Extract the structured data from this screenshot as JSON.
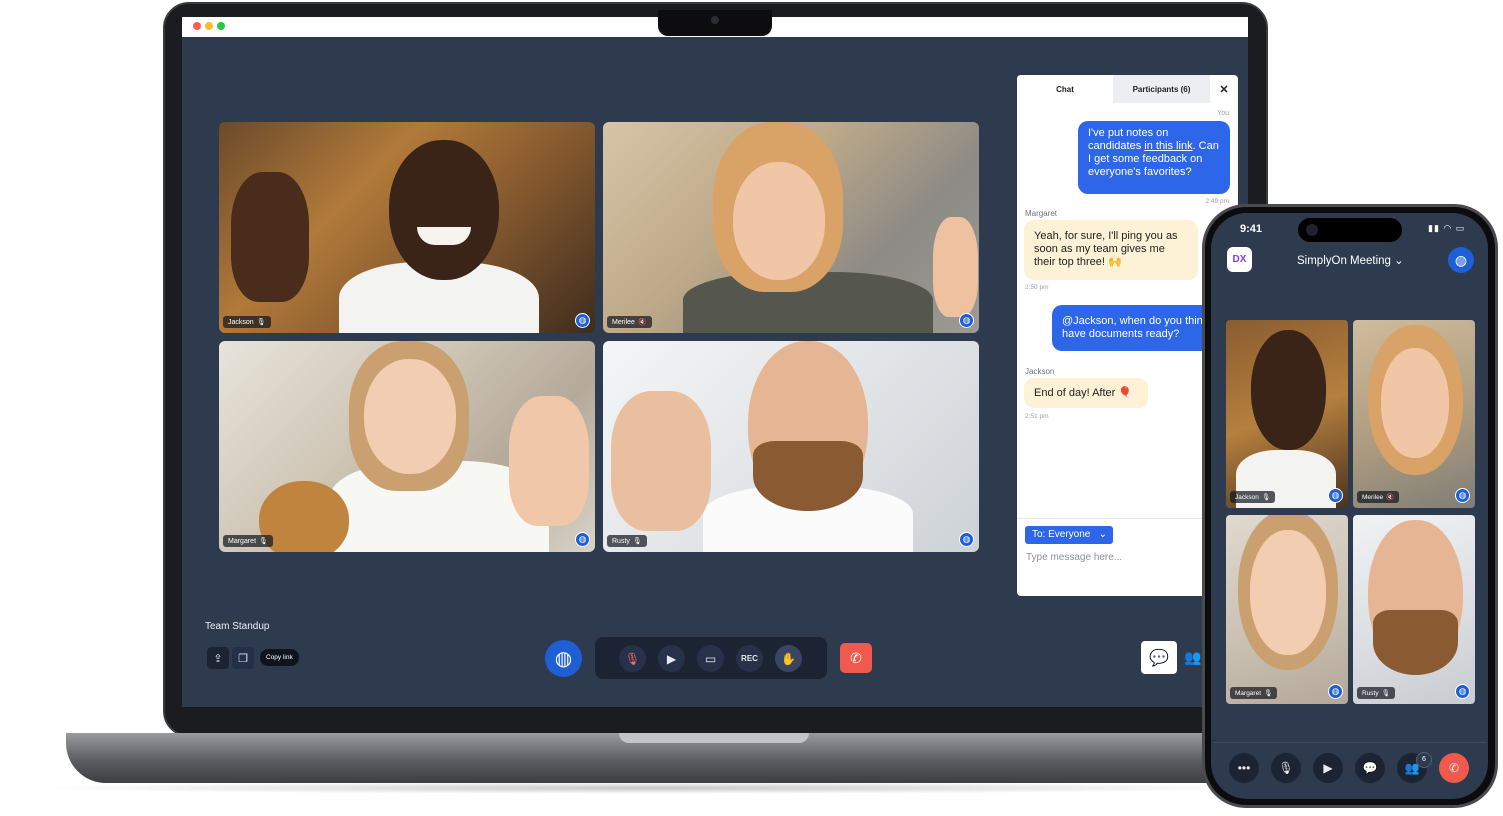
{
  "laptop": {
    "meeting_title": "Team Standup",
    "copy_link_label": "Copy link",
    "rec_label": "REC"
  },
  "participants": [
    {
      "name": "Jackson",
      "mic": "mic-on"
    },
    {
      "name": "Merilee",
      "mic": "mic-off"
    },
    {
      "name": "Margaret",
      "mic": "mic-on"
    },
    {
      "name": "Rusty",
      "mic": "mic-on"
    }
  ],
  "chat": {
    "tab_chat": "Chat",
    "tab_participants": "Participants (6)",
    "close_symbol": "✕",
    "you_label": "You",
    "messages": [
      {
        "sender": "",
        "text_pre": "I've put notes on candidates ",
        "link_text": "in this link",
        "text_post": ". Can I get some feedback on everyone's favorites?",
        "time": "2:49 pm"
      },
      {
        "sender": "Margaret",
        "text": "Yeah, for sure, I'll ping you as soon as my team gives me their top three! 🙌",
        "time": "2:50 pm"
      },
      {
        "sender": "",
        "text": "@Jackson, when do you think you'll have documents ready?",
        "time": ""
      },
      {
        "sender": "Jackson",
        "text": "End of day! After 🎈",
        "time": "2:51 pm"
      }
    ],
    "to_label": "To: Everyone",
    "input_placeholder": "Type message here..."
  },
  "phone": {
    "time": "9:41",
    "meeting_name": "SimplyOn Meeting",
    "logo_text": "DX",
    "participants_count": "6"
  },
  "colors": {
    "screen_bg": "#2e3a4d",
    "accent_blue": "#1f5fd6",
    "message_blue": "#2d66e8",
    "message_cream": "#fdf1d6",
    "end_call_red": "#ee5a4d"
  },
  "icons": [
    "globe-icon",
    "mic-icon",
    "mic-off-icon",
    "video-icon",
    "screen-share-icon",
    "raise-hand-icon",
    "end-call-icon",
    "share-icon",
    "copy-icon",
    "chat-icon",
    "participants-icon",
    "send-icon",
    "close-icon",
    "more-icon",
    "chevron-down-icon"
  ]
}
